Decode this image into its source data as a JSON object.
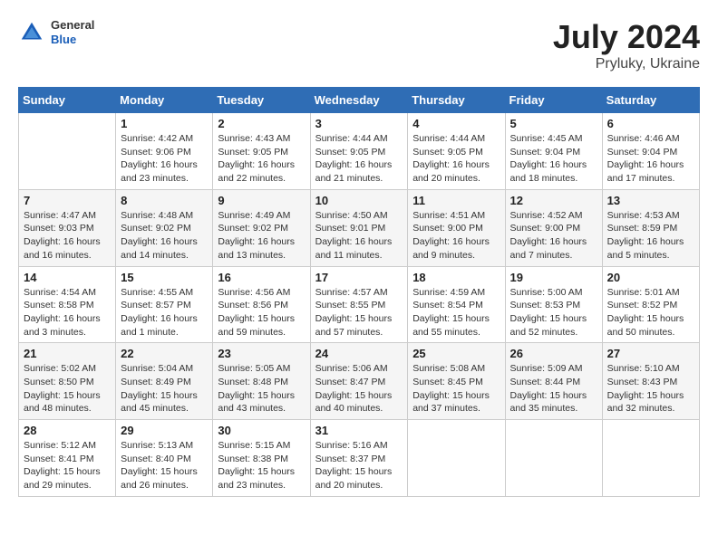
{
  "header": {
    "logo_general": "General",
    "logo_blue": "Blue",
    "title": "July 2024",
    "subtitle": "Pryluky, Ukraine"
  },
  "days_of_week": [
    "Sunday",
    "Monday",
    "Tuesday",
    "Wednesday",
    "Thursday",
    "Friday",
    "Saturday"
  ],
  "weeks": [
    [
      {
        "day": "",
        "info": ""
      },
      {
        "day": "1",
        "info": "Sunrise: 4:42 AM\nSunset: 9:06 PM\nDaylight: 16 hours\nand 23 minutes."
      },
      {
        "day": "2",
        "info": "Sunrise: 4:43 AM\nSunset: 9:05 PM\nDaylight: 16 hours\nand 22 minutes."
      },
      {
        "day": "3",
        "info": "Sunrise: 4:44 AM\nSunset: 9:05 PM\nDaylight: 16 hours\nand 21 minutes."
      },
      {
        "day": "4",
        "info": "Sunrise: 4:44 AM\nSunset: 9:05 PM\nDaylight: 16 hours\nand 20 minutes."
      },
      {
        "day": "5",
        "info": "Sunrise: 4:45 AM\nSunset: 9:04 PM\nDaylight: 16 hours\nand 18 minutes."
      },
      {
        "day": "6",
        "info": "Sunrise: 4:46 AM\nSunset: 9:04 PM\nDaylight: 16 hours\nand 17 minutes."
      }
    ],
    [
      {
        "day": "7",
        "info": "Sunrise: 4:47 AM\nSunset: 9:03 PM\nDaylight: 16 hours\nand 16 minutes."
      },
      {
        "day": "8",
        "info": "Sunrise: 4:48 AM\nSunset: 9:02 PM\nDaylight: 16 hours\nand 14 minutes."
      },
      {
        "day": "9",
        "info": "Sunrise: 4:49 AM\nSunset: 9:02 PM\nDaylight: 16 hours\nand 13 minutes."
      },
      {
        "day": "10",
        "info": "Sunrise: 4:50 AM\nSunset: 9:01 PM\nDaylight: 16 hours\nand 11 minutes."
      },
      {
        "day": "11",
        "info": "Sunrise: 4:51 AM\nSunset: 9:00 PM\nDaylight: 16 hours\nand 9 minutes."
      },
      {
        "day": "12",
        "info": "Sunrise: 4:52 AM\nSunset: 9:00 PM\nDaylight: 16 hours\nand 7 minutes."
      },
      {
        "day": "13",
        "info": "Sunrise: 4:53 AM\nSunset: 8:59 PM\nDaylight: 16 hours\nand 5 minutes."
      }
    ],
    [
      {
        "day": "14",
        "info": "Sunrise: 4:54 AM\nSunset: 8:58 PM\nDaylight: 16 hours\nand 3 minutes."
      },
      {
        "day": "15",
        "info": "Sunrise: 4:55 AM\nSunset: 8:57 PM\nDaylight: 16 hours\nand 1 minute."
      },
      {
        "day": "16",
        "info": "Sunrise: 4:56 AM\nSunset: 8:56 PM\nDaylight: 15 hours\nand 59 minutes."
      },
      {
        "day": "17",
        "info": "Sunrise: 4:57 AM\nSunset: 8:55 PM\nDaylight: 15 hours\nand 57 minutes."
      },
      {
        "day": "18",
        "info": "Sunrise: 4:59 AM\nSunset: 8:54 PM\nDaylight: 15 hours\nand 55 minutes."
      },
      {
        "day": "19",
        "info": "Sunrise: 5:00 AM\nSunset: 8:53 PM\nDaylight: 15 hours\nand 52 minutes."
      },
      {
        "day": "20",
        "info": "Sunrise: 5:01 AM\nSunset: 8:52 PM\nDaylight: 15 hours\nand 50 minutes."
      }
    ],
    [
      {
        "day": "21",
        "info": "Sunrise: 5:02 AM\nSunset: 8:50 PM\nDaylight: 15 hours\nand 48 minutes."
      },
      {
        "day": "22",
        "info": "Sunrise: 5:04 AM\nSunset: 8:49 PM\nDaylight: 15 hours\nand 45 minutes."
      },
      {
        "day": "23",
        "info": "Sunrise: 5:05 AM\nSunset: 8:48 PM\nDaylight: 15 hours\nand 43 minutes."
      },
      {
        "day": "24",
        "info": "Sunrise: 5:06 AM\nSunset: 8:47 PM\nDaylight: 15 hours\nand 40 minutes."
      },
      {
        "day": "25",
        "info": "Sunrise: 5:08 AM\nSunset: 8:45 PM\nDaylight: 15 hours\nand 37 minutes."
      },
      {
        "day": "26",
        "info": "Sunrise: 5:09 AM\nSunset: 8:44 PM\nDaylight: 15 hours\nand 35 minutes."
      },
      {
        "day": "27",
        "info": "Sunrise: 5:10 AM\nSunset: 8:43 PM\nDaylight: 15 hours\nand 32 minutes."
      }
    ],
    [
      {
        "day": "28",
        "info": "Sunrise: 5:12 AM\nSunset: 8:41 PM\nDaylight: 15 hours\nand 29 minutes."
      },
      {
        "day": "29",
        "info": "Sunrise: 5:13 AM\nSunset: 8:40 PM\nDaylight: 15 hours\nand 26 minutes."
      },
      {
        "day": "30",
        "info": "Sunrise: 5:15 AM\nSunset: 8:38 PM\nDaylight: 15 hours\nand 23 minutes."
      },
      {
        "day": "31",
        "info": "Sunrise: 5:16 AM\nSunset: 8:37 PM\nDaylight: 15 hours\nand 20 minutes."
      },
      {
        "day": "",
        "info": ""
      },
      {
        "day": "",
        "info": ""
      },
      {
        "day": "",
        "info": ""
      }
    ]
  ]
}
